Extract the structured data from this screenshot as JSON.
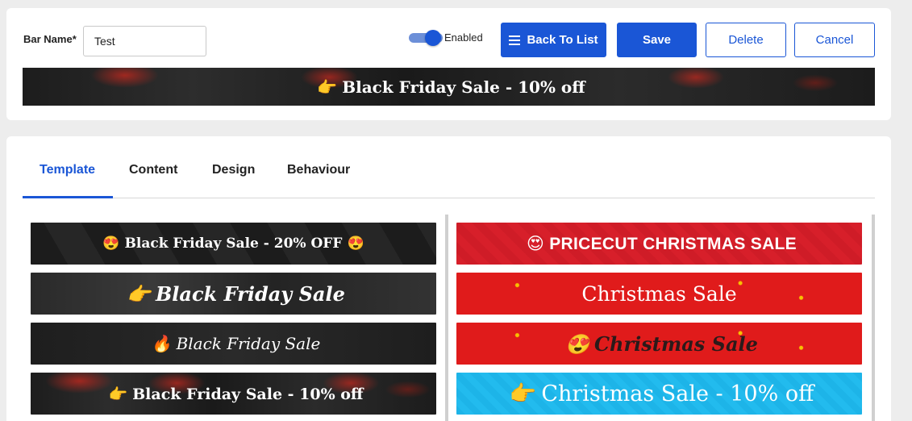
{
  "header": {
    "bar_name_label": "Bar Name*",
    "bar_name_value": "Test",
    "toggle_label": "Enabled",
    "buttons": {
      "back": "Back To List",
      "save": "Save",
      "delete": "Delete",
      "cancel": "Cancel"
    },
    "preview_text": "Black Friday Sale - 10% off",
    "preview_icon": "👉"
  },
  "tabs": [
    "Template",
    "Content",
    "Design",
    "Behaviour"
  ],
  "active_tab": "Template",
  "templates_left": [
    {
      "text": "Black Friday Sale - 20% OFF",
      "icon_left": "😍",
      "icon_right": "😍"
    },
    {
      "text": "Black Friday Sale",
      "icon_left": "👉"
    },
    {
      "text": "Black Friday Sale",
      "icon_left": "🔥"
    },
    {
      "text": "Black Friday Sale - 10% off",
      "icon_left": "👉"
    }
  ],
  "templates_right": [
    {
      "text": "PRICECUT CHRISTMAS SALE",
      "icon_left": "😍"
    },
    {
      "text": "Christmas Sale"
    },
    {
      "text": "Christmas Sale",
      "icon_left": "😍"
    },
    {
      "text": "Christmas Sale - 10% off",
      "icon_left": "👉"
    }
  ],
  "colors": {
    "primary": "#1a56d6",
    "christmas_red": "#e01b1b",
    "sky_blue": "#1db4e8"
  }
}
